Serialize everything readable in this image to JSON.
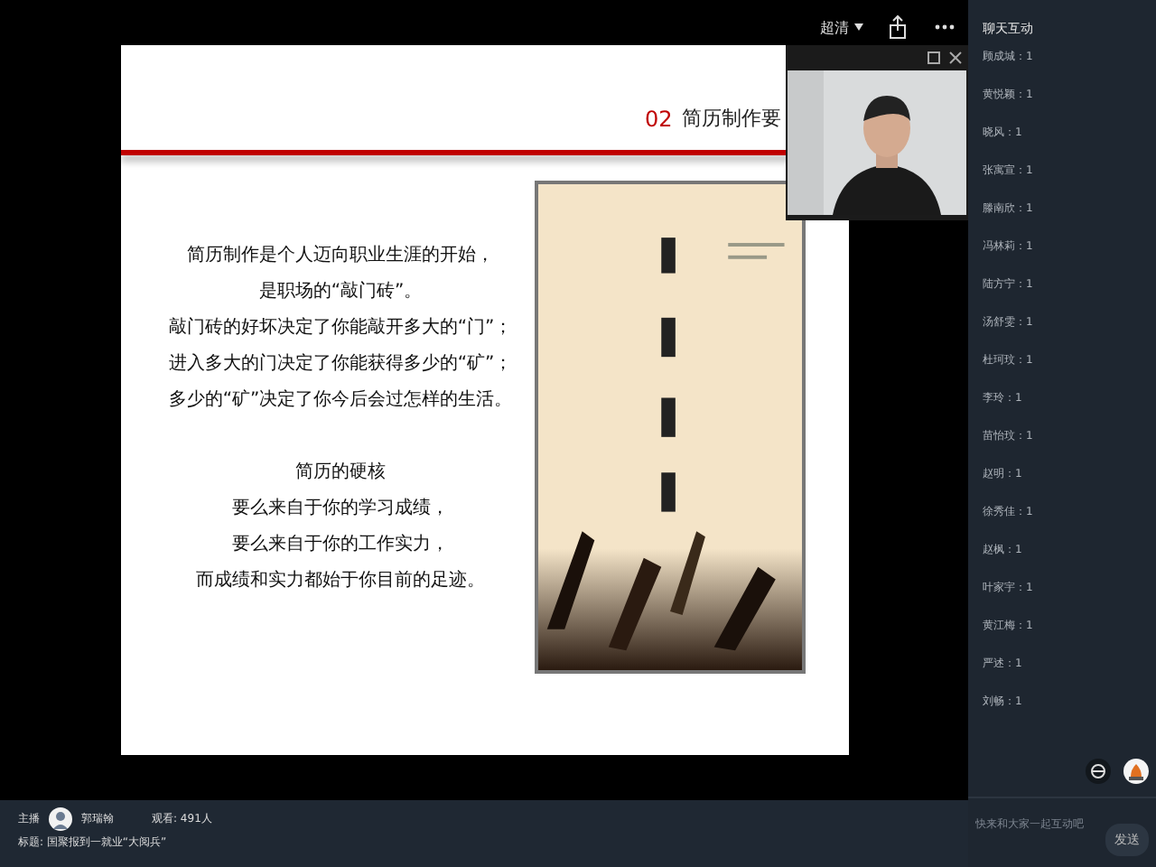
{
  "toolbar": {
    "quality": "超清"
  },
  "slide": {
    "number": "02",
    "title": "简历制作要",
    "paragraphs": [
      {
        "lines": [
          "简历制作是个人迈向职业生涯的开始，",
          "是职场的“敲门砖”。",
          "敲门砖的好坏决定了你能敲开多大的“门”；",
          "进入多大的门决定了你能获得多少的“矿”；",
          "多少的“矿”决定了你今后会过怎样的生活。"
        ]
      },
      {
        "lines": [
          "简历的硬核",
          "要么来自于你的学习成绩，",
          "要么来自于你的工作实力，",
          "而成绩和实力都始于你目前的足迹。"
        ]
      }
    ]
  },
  "info": {
    "host_label": "主播",
    "host_name": "郭瑞翰",
    "viewers": "观看: 491人",
    "title": "标题: 国聚报到一就业“大阅兵”"
  },
  "chat": {
    "title": "聊天互动",
    "messages": [
      {
        "text": "顾成城：1"
      },
      {
        "text": "黄悦颖：1"
      },
      {
        "text": "晓风：1"
      },
      {
        "text": "张寓宣：1"
      },
      {
        "text": "滕南欣：1"
      },
      {
        "text": "冯林莉：1"
      },
      {
        "text": "陆方宁：1"
      },
      {
        "text": "汤舒雯：1"
      },
      {
        "text": "杜珂玟：1"
      },
      {
        "text": "李玲：1"
      },
      {
        "text": "苗怡玟：1"
      },
      {
        "text": "赵明：1"
      },
      {
        "text": "徐秀佳：1"
      },
      {
        "text": "赵枫：1"
      },
      {
        "text": "叶家宇：1"
      },
      {
        "text": "黄江梅：1"
      },
      {
        "text": "严述：1"
      },
      {
        "text": "刘畅：1"
      }
    ],
    "placeholder": "快来和大家一起互动吧",
    "send": "发送"
  }
}
